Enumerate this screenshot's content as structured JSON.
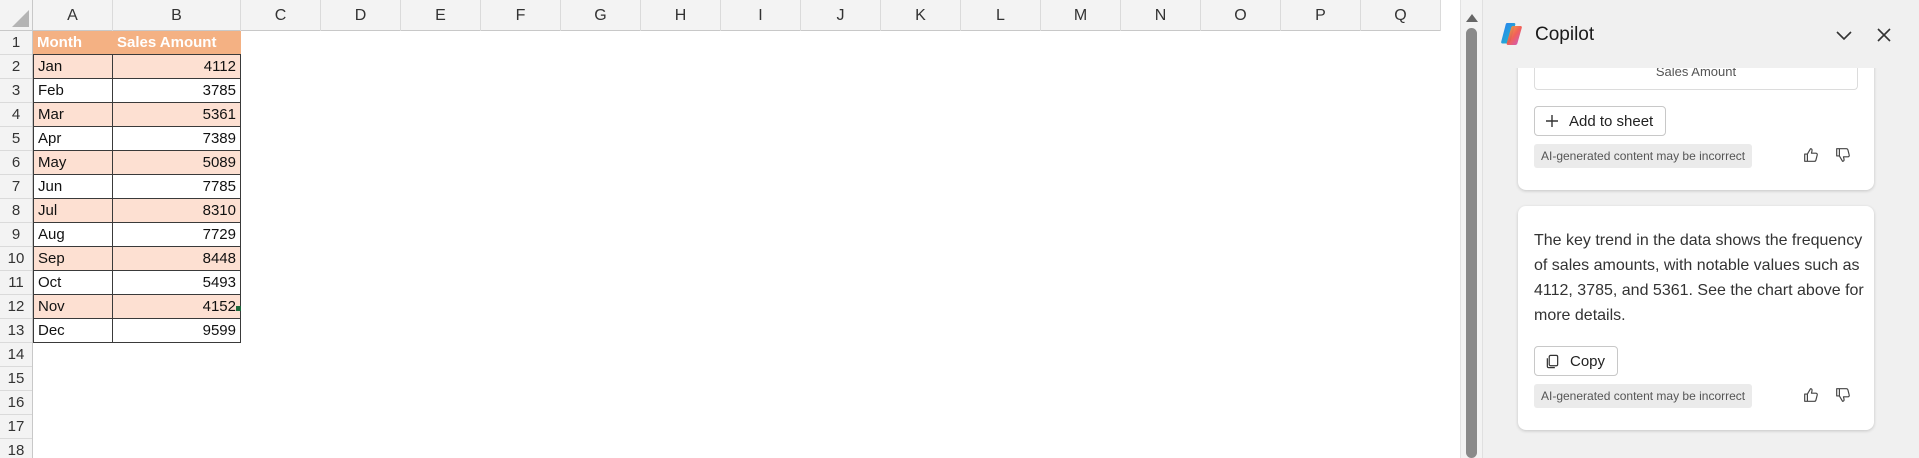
{
  "sheet": {
    "columns": [
      "A",
      "B",
      "C",
      "D",
      "E",
      "F",
      "G",
      "H",
      "I",
      "J",
      "K",
      "L",
      "M",
      "N",
      "O",
      "P",
      "Q"
    ],
    "rows": [
      "1",
      "2",
      "3",
      "4",
      "5",
      "6",
      "7",
      "8",
      "9",
      "10",
      "11",
      "12",
      "13",
      "14",
      "15",
      "16",
      "17",
      "18"
    ],
    "headers": {
      "month": "Month",
      "sales": "Sales Amount"
    },
    "data": [
      {
        "month": "Jan",
        "sales": "4112"
      },
      {
        "month": "Feb",
        "sales": "3785"
      },
      {
        "month": "Mar",
        "sales": "5361"
      },
      {
        "month": "Apr",
        "sales": "7389"
      },
      {
        "month": "May",
        "sales": "5089"
      },
      {
        "month": "Jun",
        "sales": "7785"
      },
      {
        "month": "Jul",
        "sales": "8310"
      },
      {
        "month": "Aug",
        "sales": "7729"
      },
      {
        "month": "Sep",
        "sales": "8448"
      },
      {
        "month": "Oct",
        "sales": "5493"
      },
      {
        "month": "Nov",
        "sales": "4152"
      },
      {
        "month": "Dec",
        "sales": "9599"
      }
    ],
    "colors": {
      "header_fill": "#f4b183",
      "band_fill": "#fde0d2"
    }
  },
  "copilot": {
    "title": "Copilot",
    "card1": {
      "cut_text": "Sales Amount",
      "add_button": "Add to sheet",
      "disclaimer": "AI-generated content may be incorrect"
    },
    "card2": {
      "message": "The key trend in the data shows the frequency of sales amounts, with notable values such as 4112, 3785, and 5361. See the chart above for more details.",
      "copy_button": "Copy",
      "disclaimer": "AI-generated content may be incorrect"
    },
    "icons": [
      "copilot-logo",
      "chevron-down-icon",
      "close-icon",
      "plus-icon",
      "copy-icon",
      "thumbs-up-icon",
      "thumbs-down-icon"
    ]
  }
}
